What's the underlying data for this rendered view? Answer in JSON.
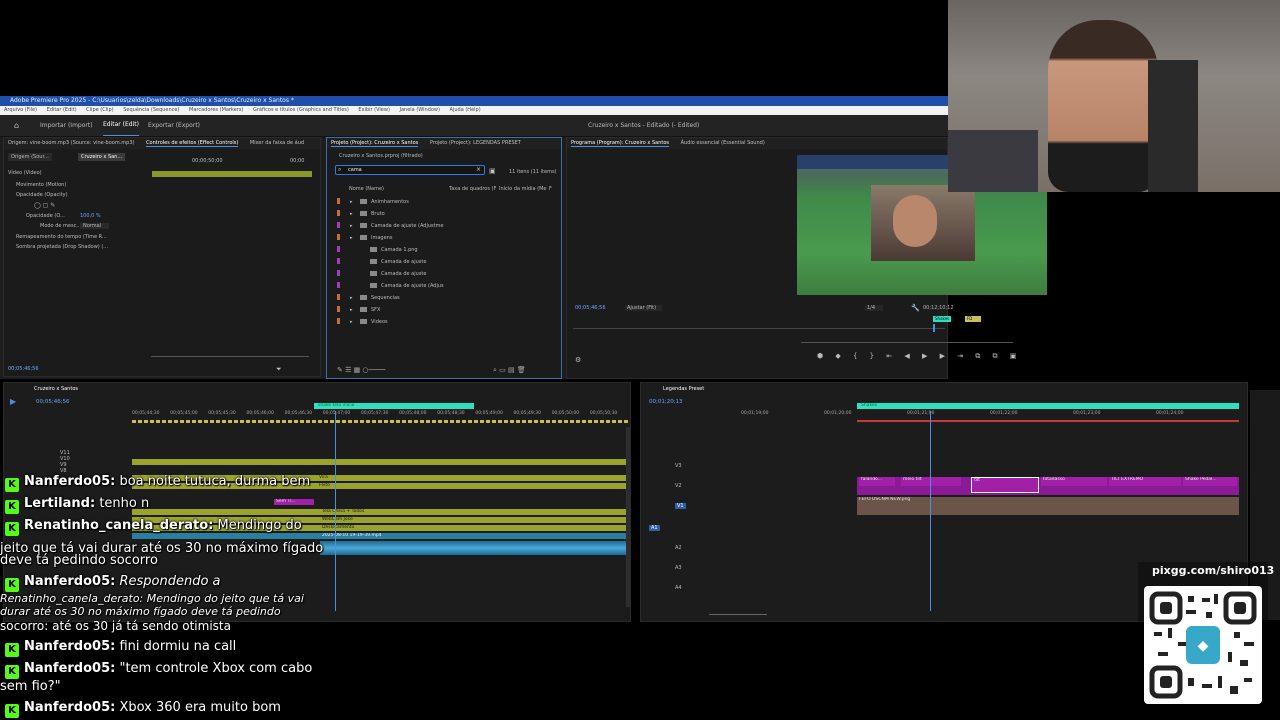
{
  "app": {
    "title": "Adobe Premiere Pro 2025 - C:\\Usuarios\\zelda\\Downloads\\Cruzeiro x Santos\\Cruzeiro x Santos *",
    "menu": [
      "Arquivo (File)",
      "Editar (Edit)",
      "Clipe (Clip)",
      "Sequência (Sequence)",
      "Marcadores (Markers)",
      "Gráficos e títulos (Graphics and Titles)",
      "Exibir (View)",
      "Janela (Window)",
      "Ajuda (Help)"
    ],
    "header_tabs": [
      "Importar (Import)",
      "Editar (Edit)",
      "Exportar (Export)"
    ],
    "project_title": "Cruzeiro x Santos - Editado (- Edited)"
  },
  "effect_panel": {
    "tabs": [
      "Origem: vine-boom.mp3 (Source: vine-boom.mp3)",
      "Controles de efeitos (Effect Controls)",
      "Mixer da faixa de áud"
    ],
    "source_label": "Origem (Sour...",
    "seq_label": "Cruzeiro x San...",
    "timecode": "00;00;50;00",
    "timecode2": "00;00",
    "items": [
      "Vídeo (Video)",
      "Movimento (Motion)",
      "Opacidade (Opacity)",
      "Opacidade (O...",
      "100,0 %",
      "Modo de mesc...",
      "Normal",
      "Remapeamento do tempo (Time R...",
      "Sombra projetada (Drop Shadow) (..."
    ],
    "bottom_time": "00;05;46;56"
  },
  "project_panel": {
    "tabs": [
      "Projeto (Project): Cruzeiro x Santos",
      "Projeto (Project): LEGENDAS PRESET"
    ],
    "path": "Cruzeiro x Santos.prproj (filtrado)",
    "search": "cama",
    "items_count": "11 itens (11 items)",
    "columns": [
      "Nome (Name)",
      "Taxa de quadros (F",
      "Início da mídia (Me",
      "F"
    ],
    "rows": [
      {
        "name": "Animhamentos",
        "indent": 1,
        "color": "#c8702a"
      },
      {
        "name": "Bruto",
        "indent": 1,
        "color": "#c8702a"
      },
      {
        "name": "Camada de ajuste (Adjustme",
        "indent": 1,
        "color": "#a040b8"
      },
      {
        "name": "Imagens",
        "indent": 1,
        "color": "#c8702a"
      },
      {
        "name": "Camada 1.png",
        "indent": 2,
        "color": "#a040b8"
      },
      {
        "name": "Camada de ajuste",
        "indent": 2,
        "color": "#a040b8"
      },
      {
        "name": "Camada de ajuste",
        "indent": 2,
        "color": "#a040b8"
      },
      {
        "name": "Camada de ajuste (Adjus",
        "indent": 2,
        "color": "#a040b8"
      },
      {
        "name": "Sequencias",
        "indent": 1,
        "color": "#c8702a"
      },
      {
        "name": "SFX",
        "indent": 1,
        "color": "#c8702a"
      },
      {
        "name": "Videos",
        "indent": 1,
        "color": "#c8702a"
      }
    ]
  },
  "program_panel": {
    "tabs": [
      "Programa (Program): Cruzeiro x Santos",
      "Áudio essencial (Essential Sound)"
    ],
    "timecode": "00;05;46;56",
    "fit": "Ajustar (Fit)",
    "scale": "1/4",
    "duration": "00;12;10;12",
    "markers": [
      "Shakes",
      "FD"
    ]
  },
  "timeline_left": {
    "tab": "Cruzeiro x Santos",
    "timecode": "00;05;46;56",
    "ruler": [
      "00;05;44;30",
      "00;05;45;00",
      "00;05;45;30",
      "00;05;46;00",
      "00;05;46;30",
      "00;05;47;00",
      "00;05;47;30",
      "00;05;48;00",
      "00;05;48;30",
      "00;05;49;00",
      "00;05;49;30",
      "00;05;50;00",
      "00;05;50;30"
    ],
    "marker": "shake tela inicio",
    "tracks": [
      "V11",
      "V10",
      "V9",
      "V8"
    ],
    "clips": [
      "Tela Cheia + Todos",
      "WebCam Jose",
      "Deslocamento",
      "2025-08-10 19-19-39.mp4",
      "Tela Cheia + Todos",
      "WebCam Jose",
      "Deslocamento",
      "2025-08-10 19-19-39.mp4",
      "Vira",
      "Feito",
      "Sem Tí..."
    ]
  },
  "timeline_right": {
    "tab": "Legendas Preset",
    "timecode": "00;01;20;13",
    "ruler": [
      "00;01;19;00",
      "00;01;20;00",
      "00;01;21;00",
      "00;01;22;00",
      "00;01;23;00",
      "00;01;24;00"
    ],
    "marker": "Shakes",
    "tracks": [
      "V3",
      "V2",
      "V1",
      "A1",
      "A2",
      "A3",
      "A4"
    ],
    "clips": [
      "falando...",
      "meio tilt",
      "tilt",
      "tiltadasso",
      "TILT EXTREMO",
      "Shake Pedal..."
    ],
    "img_clip": "FEFO DSCNM NEW.png"
  },
  "chat": [
    {
      "user": "Nanferdo05:",
      "msg": "boa noite tutuca, durma bem",
      "style": "normal"
    },
    {
      "user": "Lertiland:",
      "msg": "tenho n",
      "style": "normal"
    },
    {
      "user": "Renatinho_canela_derato:",
      "msg": "Mendingo do",
      "style": "normal"
    },
    {
      "user": "",
      "msg": "jeito que tá vai durar até os 30 no máximo fígado",
      "style": "cont"
    },
    {
      "user": "",
      "msg": "deve tá pedindo socorro",
      "style": "cont"
    },
    {
      "user": "Nanferdo05:",
      "msg": "Respondendo a",
      "style": "reply"
    },
    {
      "user": "",
      "msg": "Renatinho_canela_derato: Mendingo do jeito que tá vai",
      "style": "quote"
    },
    {
      "user": "",
      "msg": "durar até os 30 no máximo fígado deve tá pedindo",
      "style": "quote"
    },
    {
      "user": "",
      "msg": "socorro:  até os 30 já tá sendo otimista",
      "style": "quotetail"
    },
    {
      "user": "Nanferdo05:",
      "msg": "fini dormiu na call",
      "style": "normal"
    },
    {
      "user": "Nanferdo05:",
      "msg": "\"tem controle Xbox com cabo",
      "style": "normal"
    },
    {
      "user": "",
      "msg": "sem fio?\"",
      "style": "cont"
    },
    {
      "user": "Nanferdo05:",
      "msg": "Xbox 360 era muito bom",
      "style": "normal"
    }
  ],
  "overlay": {
    "url": "pixgg.com/shiro013"
  },
  "colors": {
    "accent": "#4a90e2",
    "kick": "#53fc18",
    "clip_video": "#9aa32a",
    "clip_purple": "#a020a8",
    "clip_audio": "#2b7ea0",
    "marker": "#2ee0c0"
  }
}
